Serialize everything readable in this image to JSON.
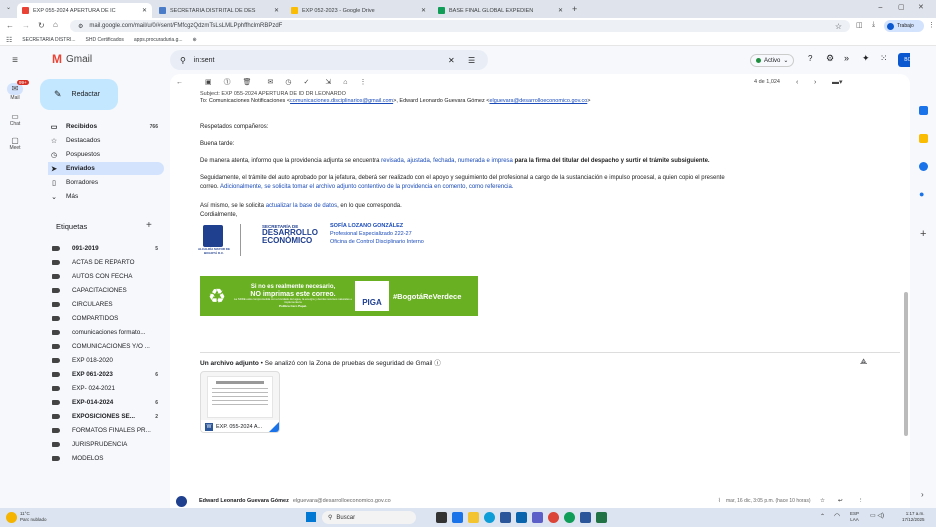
{
  "browser": {
    "tabs": [
      {
        "title": "EXP 055-2024 APERTURA DE IC"
      },
      {
        "title": "SECRETARIA DISTRITAL DE DES"
      },
      {
        "title": "EXP 052-2023 - Google Drive"
      },
      {
        "title": "BASE FINAL GLOBAL EXPEDIEN"
      }
    ],
    "url": "mail.google.com/mail/u/0/#sent/FMfcgzQdzmTsLsLMLPphffhclmRBPzdF",
    "profile_label": "Trabajo",
    "bookmarks": [
      "SECRETARIA DISTRI...",
      "SHD Certificados",
      "apps.procuraduria.g..."
    ]
  },
  "gmail": {
    "logo": "Gmail",
    "search_value": "in:sent",
    "status": "Activo",
    "brand_badge": "BOGOTÁ",
    "rail": [
      "Mail",
      "Chat",
      "Meet"
    ],
    "rail_badge": "99+",
    "compose": "Redactar",
    "nav": [
      {
        "label": "Recibidos",
        "count": "766",
        "icon": "inbox-icon"
      },
      {
        "label": "Destacados",
        "count": "",
        "icon": "star-icon"
      },
      {
        "label": "Pospuestos",
        "count": "",
        "icon": "clock-icon"
      },
      {
        "label": "Enviados",
        "count": "",
        "icon": "send-icon"
      },
      {
        "label": "Borradores",
        "count": "",
        "icon": "draft-icon"
      },
      {
        "label": "Más",
        "count": "",
        "icon": "chevron-down-icon"
      }
    ],
    "labels_header": "Etiquetas",
    "labels": [
      {
        "label": "091-2019",
        "count": "5",
        "bold": true
      },
      {
        "label": "ACTAS DE REPARTO",
        "count": "",
        "bold": false
      },
      {
        "label": "AUTOS CON FECHA",
        "count": "",
        "bold": false
      },
      {
        "label": "CAPACITACIONES",
        "count": "",
        "bold": false
      },
      {
        "label": "CIRCULARES",
        "count": "",
        "bold": false
      },
      {
        "label": "COMPARTIDOS",
        "count": "",
        "bold": false
      },
      {
        "label": "comunicaciones formato...",
        "count": "",
        "bold": false
      },
      {
        "label": "COMUNICACIONES Y/O ...",
        "count": "",
        "bold": false
      },
      {
        "label": "EXP 018-2020",
        "count": "",
        "bold": false
      },
      {
        "label": "EXP 061-2023",
        "count": "6",
        "bold": true
      },
      {
        "label": "EXP- 024-2021",
        "count": "",
        "bold": false
      },
      {
        "label": "EXP-014-2024",
        "count": "6",
        "bold": true
      },
      {
        "label": "EXPOSICIONES SE...",
        "count": "2",
        "bold": true
      },
      {
        "label": "FORMATOS FINALES PR...",
        "count": "",
        "bold": false
      },
      {
        "label": "JURISPRUDENCIA",
        "count": "",
        "bold": false
      },
      {
        "label": "MODELOS",
        "count": "",
        "bold": false
      }
    ],
    "pagination": "4 de 1,024"
  },
  "email": {
    "subject_line": "Subject: EXP 055-2024 APERTURA DE ID DR LEONARDO",
    "to_prefix": "To: Comunicaciones Notificaciones <",
    "to_email1": "comunicaciones.disciplinarios@gmail.com",
    "to_mid": ">, Edward Leonardo Guevara Gómez <",
    "to_email2": "elguevara@desarrolloeconomico.gov.co",
    "to_end": ">",
    "greeting": "Respetados compañeros:",
    "salute": "Buena tarde:",
    "p1_a": "De manera atenta, informo que la providencia adjunta se encuentra ",
    "p1_b": "revisada, ajustada, fechada, numerada e impresa",
    "p1_c": " para la firma del titular del despacho y surtir el trámite subsiguiente.",
    "p2_a": "Seguidamente, el trámite del auto aprobado por la jefatura, deberá ser realizado con el apoyo y seguimiento del  profesional a cargo de la sustanciación e impulso procesal, a quien copio el presente",
    "p2_b": "correo. ",
    "p2_c": "Adicionalmente, se solicita tomar el archivo adjunto contentivo de la providencia en comento, como referencia.",
    "p3_a": "Así mismo,  se le solicita ",
    "p3_b": "actualizar la base de datos",
    "p3_c": ", en lo que corresponda.",
    "closing": "Cordialmente,",
    "sig_name": "SOFÍA LOZANO GONZÁLEZ",
    "sig_role": "Profesional Especializado 222-27",
    "sig_office": "Oficina de Control Disciplinario Interno",
    "sec_1": "SECRETARÍA DE",
    "sec_2": "DESARROLLO",
    "sec_3": "ECONÓMICO",
    "alc": "ALCALDÍA MAYOR DE BOGOTÁ D.C.",
    "eco_1": "Si no es realmente necesario,",
    "eco_2": "NO imprimas este correo.",
    "eco_3": "La SDDE está comprometida con el cuidado del agua, la energía y demás recursos naturales e implementa la",
    "eco_4": "Política Cero Papel.",
    "piga": "PIGA",
    "hashtag": "#BogotáReVerdece",
    "attach_title": "Un archivo adjunto",
    "attach_note": " • Se analizó con la Zona de pruebas de seguridad de Gmail",
    "attach_file": "EXP. 055-2024 A...",
    "next_sender": "Edward Leonardo Guevara Gómez",
    "next_email": "elguevara@desarrolloeconomico.gov.co",
    "next_time": "mar, 16 dic, 3:05 p.m. (hace 10 horas)"
  },
  "taskbar": {
    "weather_temp": "11°C",
    "weather_desc": "Parc nublado",
    "search": "Buscar",
    "lang": "ESP",
    "lang2": "LAA",
    "time": "1:17 a.m.",
    "date": "17/12/2025"
  },
  "colors": {
    "accent": "#0b57d0",
    "selected_nav": "#d3e3fd",
    "link": "#1a4bb8",
    "green": "#6ab023"
  }
}
